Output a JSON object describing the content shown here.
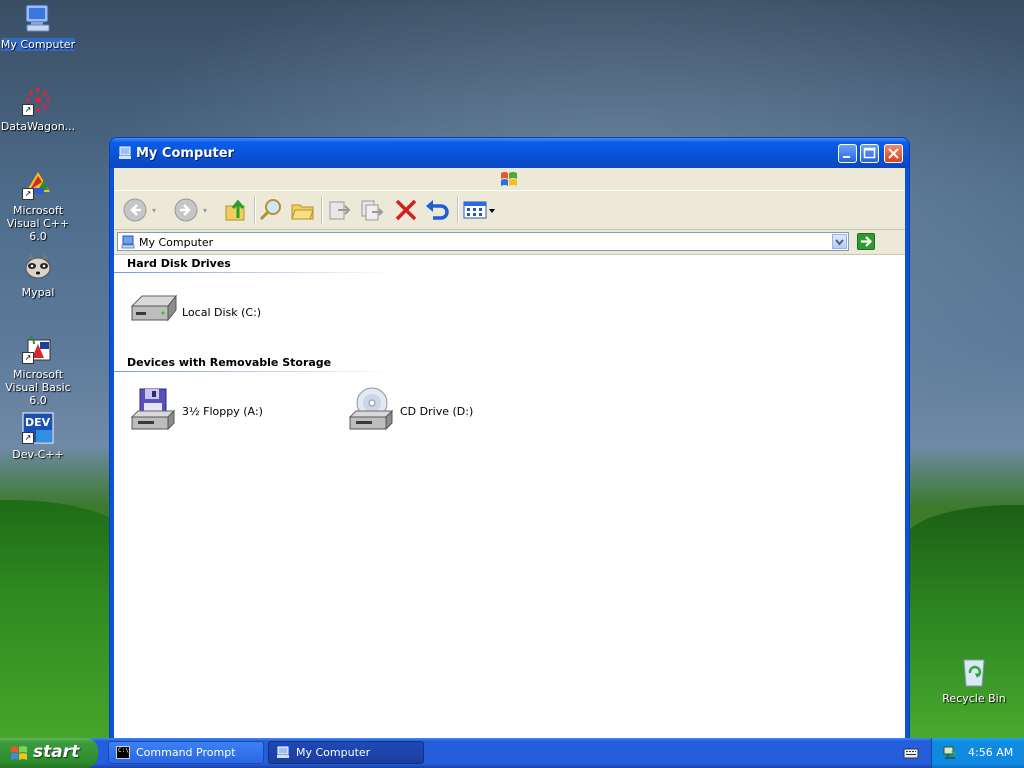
{
  "desktop": {
    "icons": [
      {
        "label": "My Computer"
      },
      {
        "label": "DataWagon..."
      },
      {
        "label": "Microsoft Visual C++ 6.0"
      },
      {
        "label": "Mypal"
      },
      {
        "label": "Microsoft Visual Basic 6.0"
      },
      {
        "label": "Dev-C++"
      },
      {
        "label": "Recycle Bin"
      }
    ],
    "dev_badge": "DEV"
  },
  "window": {
    "title": "My Computer",
    "address": "My Computer",
    "groups": [
      {
        "heading": "Hard Disk Drives",
        "items": [
          {
            "label": "Local Disk (C:)",
            "icon": "hard-disk-icon"
          }
        ]
      },
      {
        "heading": "Devices with Removable Storage",
        "items": [
          {
            "label": "3½ Floppy (A:)",
            "icon": "floppy-drive-icon"
          },
          {
            "label": "CD Drive (D:)",
            "icon": "cd-drive-icon"
          }
        ]
      }
    ],
    "toolbar_icons": [
      "back-icon",
      "forward-icon",
      "up-folder-icon",
      "search-icon",
      "folders-icon",
      "move-to-icon",
      "copy-to-icon",
      "delete-icon",
      "undo-icon",
      "views-icon"
    ]
  },
  "taskbar": {
    "start_label": "start",
    "buttons": [
      {
        "label": "Command Prompt",
        "active": false
      },
      {
        "label": "My Computer",
        "active": true
      }
    ],
    "clock": "4:56 AM",
    "cmd_icon_text": "C:\\"
  },
  "colors": {
    "titlebar": "#0a5de9",
    "start_green": "#3c9b3c",
    "taskbar_blue": "#245edb",
    "tray_blue": "#0f8ae0"
  }
}
